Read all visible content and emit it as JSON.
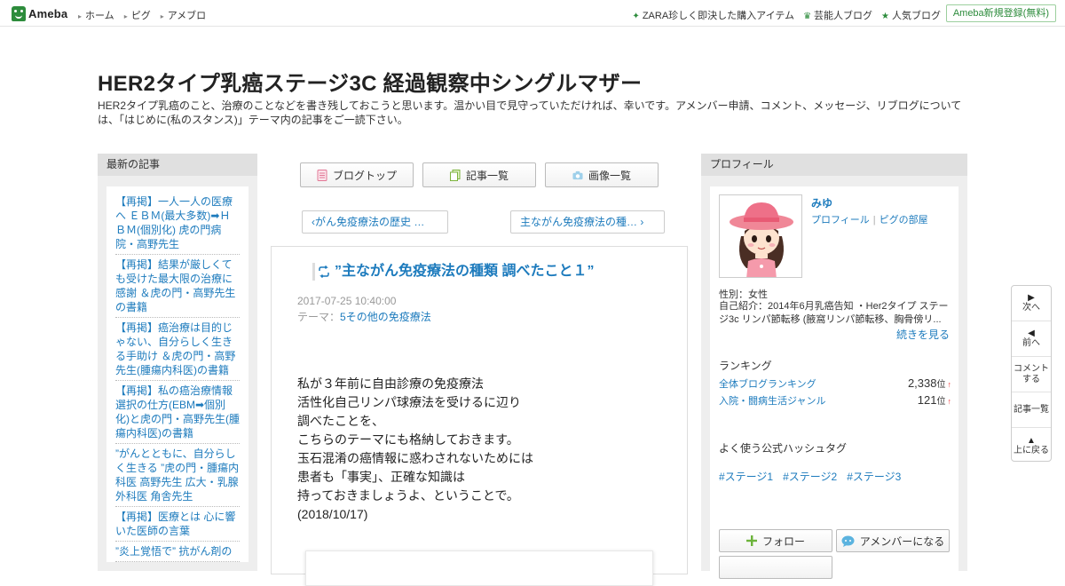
{
  "topbar": {
    "logo_text": "Ameba",
    "nav": [
      "ホーム",
      "ピグ",
      "アメブロ"
    ],
    "links": [
      {
        "icon": "sparkle-icon",
        "glyph": "✦",
        "label": "ZARA珍しく即決した購入アイテム"
      },
      {
        "icon": "crown-icon",
        "glyph": "♛",
        "label": "芸能人ブログ"
      },
      {
        "icon": "star-icon",
        "glyph": "★",
        "label": "人気ブログ"
      }
    ],
    "register": "Ameba新規登録(無料)"
  },
  "header": {
    "title": "HER2タイプ乳癌ステージ3C 経過観察中シングルマザー",
    "description": "HER2タイプ乳癌のこと、治療のことなどを書き残しておこうと思います。温かい目で見守っていただければ、幸いです。アメンバー申請、コメント、メッセージ、リブログについては、「はじめに(私のスタンス)」テーマ内の記事をご一読下さい。"
  },
  "recent": {
    "heading": "最新の記事",
    "items": [
      "【再掲】一人一人の医療へ ＥＢＭ(最大多数)➡ＨＢＭ(個別化) 虎の門病院・高野先生",
      "【再掲】結果が厳しくても受けた最大限の治療に感謝 ＆虎の門・高野先生の書籍",
      "【再掲】癌治療は目的じゃない、自分らしく生きる手助け ＆虎の門・高野先生(腫瘍内科医)の書籍",
      "【再掲】私の癌治療情報選択の仕方(EBM➡個別化)と虎の門・高野先生(腫瘍内科医)の書籍",
      "”がんとともに、自分らしく生きる ”虎の門・腫瘍内科医 高野先生 広大・乳腺外科医 角舎先生",
      "【再掲】医療とは 心に響いた医師の言葉",
      "”炎上覚悟で” 抗がん剤の"
    ]
  },
  "tabs": [
    {
      "label": "ブログトップ",
      "icon": "document-icon"
    },
    {
      "label": "記事一覧",
      "icon": "list-copy-icon"
    },
    {
      "label": "画像一覧",
      "icon": "camera-icon"
    }
  ],
  "pager": {
    "prev": "がん免疫療法の歴史 …",
    "next": "主ながん免疫療法の種…"
  },
  "article": {
    "title": "”主ながん免疫療法の種類 調べたこと１”",
    "date": "2017-07-25 10:40:00",
    "theme_label": "テーマ：",
    "theme": "5その他の免疫療法",
    "body": [
      "私が３年前に自由診療の免疫療法",
      "活性化自己リンパ球療法を受けるに辺り",
      "調べたことを、",
      "こちらのテーマにも格納しておきます。",
      "玉石混淆の癌情報に惑わされないためには",
      "患者も「事実」、正確な知識は",
      "持っておきましょうよ、ということで。",
      "(2018/10/17)"
    ]
  },
  "profile": {
    "heading": "プロフィール",
    "name": "みゆ",
    "link_profile": "プロフィール",
    "link_pig": "ピグの部屋",
    "sex": "性別：女性",
    "intro": "自己紹介：2014年6月乳癌告知 ・Her2タイプ ステージ3c リンパ節転移 (腋窩リンパ節転移、胸骨傍リ...",
    "more": "続きを見る",
    "ranking_heading": "ランキング",
    "rankings": [
      {
        "label": "全体ブログランキング",
        "value": "2,338",
        "unit": "位",
        "trend": "↑"
      },
      {
        "label": "入院・闘病生活ジャンル",
        "value": "121",
        "unit": "位",
        "trend": "↑"
      }
    ],
    "hashtag_heading": "よく使う公式ハッシュタグ",
    "hashtags": [
      "#ステージ1",
      "#ステージ2",
      "#ステージ3"
    ],
    "follow": "フォロー",
    "member": "アメンバーになる"
  },
  "sidenav": [
    {
      "icon": "next-icon",
      "glyph": "▶",
      "label": "次へ"
    },
    {
      "icon": "prev-icon",
      "glyph": "◀",
      "label": "前へ"
    },
    {
      "icon": "",
      "glyph": "",
      "label": "コメント\nする"
    },
    {
      "icon": "",
      "glyph": "",
      "label": "記事一覧"
    },
    {
      "icon": "up-icon",
      "glyph": "▲",
      "label": "上に戻る"
    }
  ]
}
